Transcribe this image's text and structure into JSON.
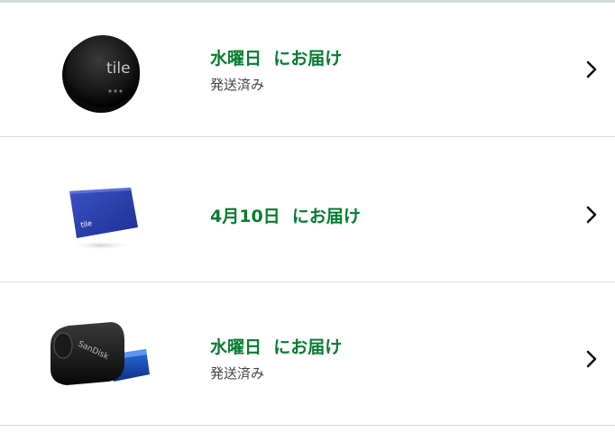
{
  "orders": [
    {
      "delivery": "水曜日  にお届け",
      "status": "発送済み",
      "product_icon": "tile-sticker-round-black",
      "product_logo": "tile"
    },
    {
      "delivery": "4月10日  にお届け",
      "status": "",
      "product_icon": "tile-slim-card-blue",
      "product_logo": "tile"
    },
    {
      "delivery": "水曜日  にお届け",
      "status": "発送済み",
      "product_icon": "sandisk-usb-flash-drive",
      "product_logo": "SanDisk"
    }
  ],
  "colors": {
    "delivery_green": "#067d30",
    "status_gray": "#444444",
    "divider": "#dddddd",
    "chevron": "#111111"
  }
}
